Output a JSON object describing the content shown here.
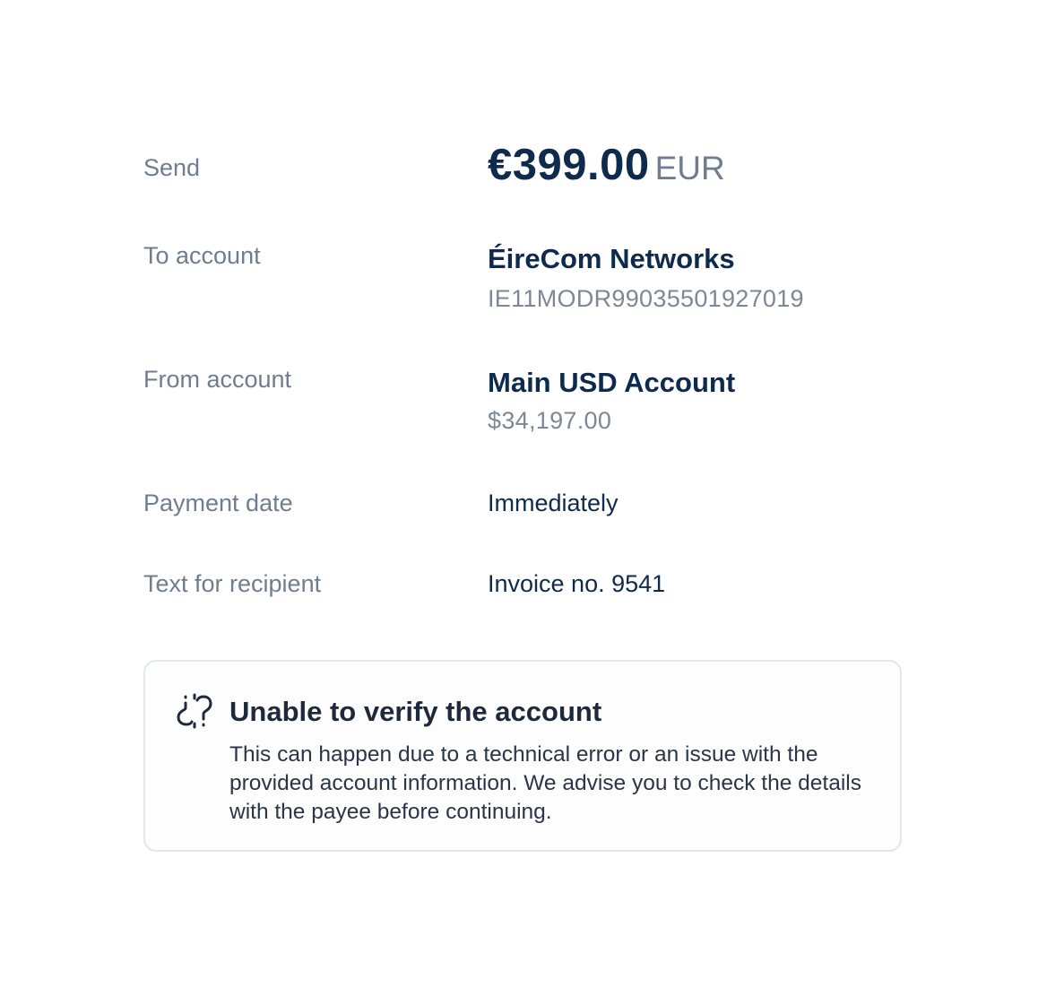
{
  "send": {
    "label": "Send",
    "amount": "€399.00",
    "currency": "EUR"
  },
  "to_account": {
    "label": "To account",
    "name": "ÉireCom Networks",
    "iban": "IE11MODR99035501927019"
  },
  "from_account": {
    "label": "From account",
    "name": "Main USD Account",
    "balance": "$34,197.00"
  },
  "payment_date": {
    "label": "Payment date",
    "value": "Immediately"
  },
  "recipient_text": {
    "label": "Text for recipient",
    "value": "Invoice no. 9541"
  },
  "notice": {
    "icon": "broken-link-question-icon",
    "title": "Unable to verify the account",
    "body": "This can happen due to a technical error or an issue with the provided account information. We advise you to check the details with the payee before continuing."
  },
  "colors": {
    "primary_text": "#0e2a4d",
    "muted_text": "#6f7d8f",
    "notice_border": "#e3e6ee"
  }
}
